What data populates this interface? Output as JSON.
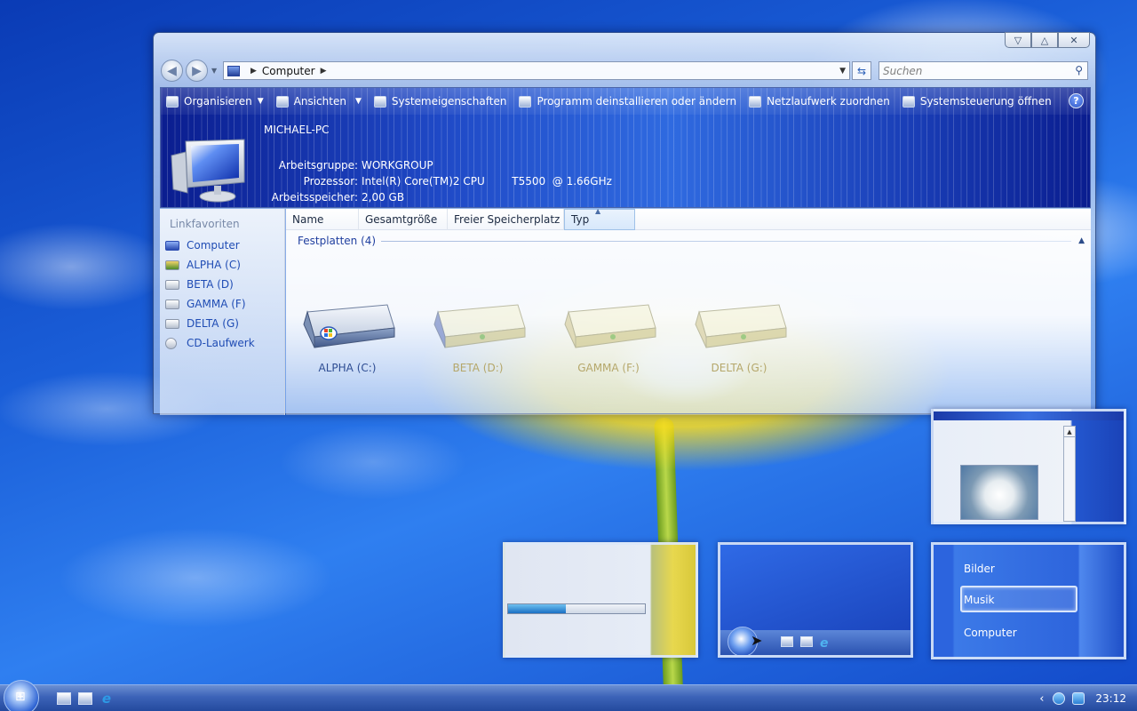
{
  "window": {
    "address": {
      "location": "Computer"
    },
    "search": {
      "placeholder": "Suchen"
    },
    "controls": {
      "minimize": "▽",
      "maximize": "△",
      "close": "✕"
    }
  },
  "toolbar": {
    "items": [
      {
        "label": "Organisieren",
        "icon": "organize-icon"
      },
      {
        "label": "Ansichten",
        "icon": "views-icon"
      },
      {
        "label": "Systemeigenschaften",
        "icon": "system-properties-icon"
      },
      {
        "label": "Programm deinstallieren oder ändern",
        "icon": "uninstall-program-icon"
      },
      {
        "label": "Netzlaufwerk zuordnen",
        "icon": "map-network-drive-icon"
      },
      {
        "label": "Systemsteuerung öffnen",
        "icon": "control-panel-icon"
      }
    ],
    "help": "?"
  },
  "details": {
    "pc_name": "MICHAEL-PC",
    "rows": [
      {
        "label": "Arbeitsgruppe:",
        "value": "WORKGROUP"
      },
      {
        "label": "Prozessor:",
        "value": "Intel(R) Core(TM)2 CPU        T5500  @ 1.66GHz"
      },
      {
        "label": "Arbeitsspeicher:",
        "value": "2,00 GB"
      }
    ]
  },
  "nav_pane": {
    "title": "Linkfavoriten",
    "items": [
      {
        "label": "Computer",
        "icon": "computer-icon"
      },
      {
        "label": "ALPHA (C)",
        "icon": "drive-c-icon"
      },
      {
        "label": "BETA (D)",
        "icon": "drive-d-icon"
      },
      {
        "label": "GAMMA (F)",
        "icon": "drive-f-icon"
      },
      {
        "label": "DELTA (G)",
        "icon": "drive-g-icon"
      },
      {
        "label": "CD-Laufwerk",
        "icon": "cd-drive-icon"
      }
    ]
  },
  "columns": [
    {
      "label": "Name"
    },
    {
      "label": "Gesamtgröße"
    },
    {
      "label": "Freier Speicherplatz"
    },
    {
      "label": "Typ",
      "sorted": true
    }
  ],
  "group": {
    "label": "Festplatten (4)"
  },
  "drives": [
    {
      "label": "ALPHA (C:)",
      "system": true
    },
    {
      "label": "BETA (D:)",
      "system": false
    },
    {
      "label": "GAMMA (F:)",
      "system": false
    },
    {
      "label": "DELTA (G:)",
      "system": false
    }
  ],
  "thumbnails": {
    "progress_fraction": 0.42,
    "menu": {
      "items": [
        "Bilder",
        "Musik",
        "Computer"
      ],
      "selected": "Musik"
    }
  },
  "taskbar": {
    "clock": "23:12",
    "tray_arrow": "‹"
  },
  "colors": {
    "accent_link": "#1f4cb4",
    "banner_blue": "#1f49c6",
    "taskbar_blue": "#3c63b8"
  }
}
